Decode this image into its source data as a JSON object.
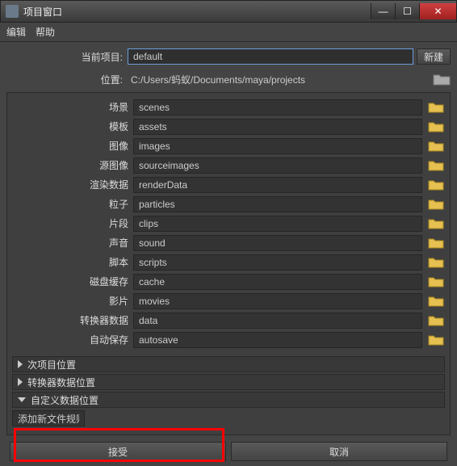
{
  "window": {
    "title": "项目窗口"
  },
  "menu": {
    "edit": "编辑",
    "help": "帮助"
  },
  "current": {
    "label": "当前项目:",
    "value": "default",
    "new_btn": "新建"
  },
  "location": {
    "label": "位置:",
    "path": "C:/Users/蚂蚁/Documents/maya/projects"
  },
  "rows": [
    {
      "label": "场景",
      "value": "scenes"
    },
    {
      "label": "模板",
      "value": "assets"
    },
    {
      "label": "图像",
      "value": "images"
    },
    {
      "label": "源图像",
      "value": "sourceimages"
    },
    {
      "label": "渲染数据",
      "value": "renderData"
    },
    {
      "label": "粒子",
      "value": "particles"
    },
    {
      "label": "片段",
      "value": "clips"
    },
    {
      "label": "声音",
      "value": "sound"
    },
    {
      "label": "脚本",
      "value": "scripts"
    },
    {
      "label": "磁盘缓存",
      "value": "cache"
    },
    {
      "label": "影片",
      "value": "movies"
    },
    {
      "label": "转换器数据",
      "value": "data"
    },
    {
      "label": "自动保存",
      "value": "autosave"
    }
  ],
  "sections": {
    "secondary": "次项目位置",
    "translator": "转换器数据位置",
    "custom": "自定义数据位置"
  },
  "custom_sub": {
    "placeholder": "添加新文件规则"
  },
  "buttons": {
    "accept": "接受",
    "cancel": "取消"
  },
  "win_controls": {
    "min": "—",
    "max": "☐",
    "close": "✕"
  }
}
